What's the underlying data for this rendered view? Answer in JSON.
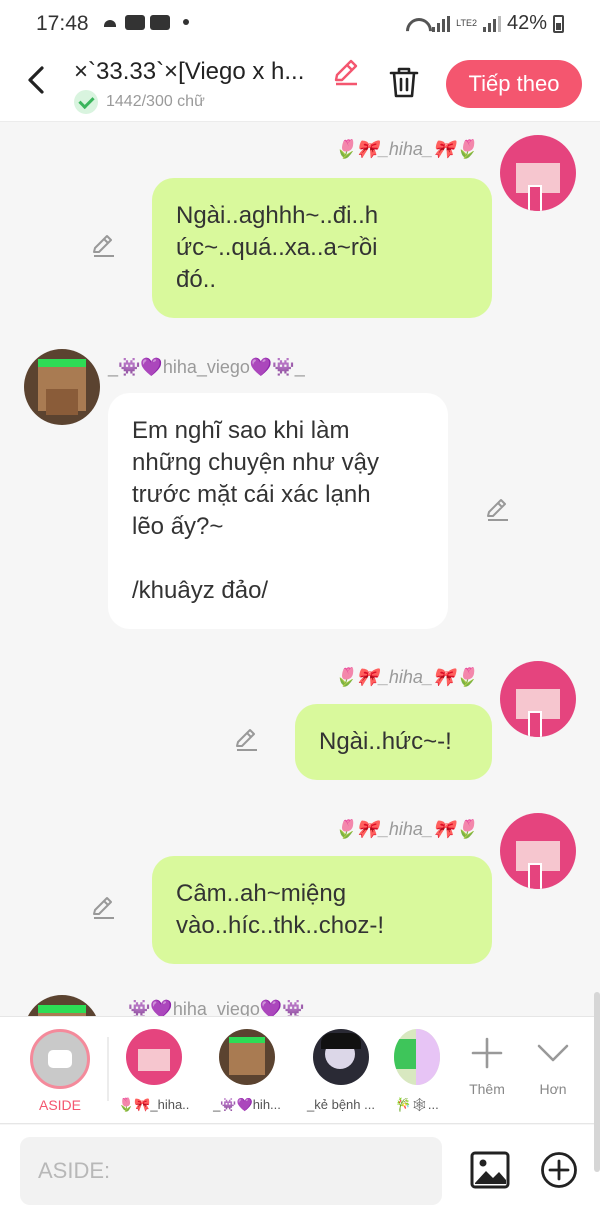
{
  "status_bar": {
    "time": "17:48",
    "battery": "42%",
    "network": "LTE2"
  },
  "header": {
    "title": "×`33.33`×[Viego x h...",
    "char_count": "1442/300 chữ",
    "next_label": "Tiếp theo",
    "accent_color": "#f4566f"
  },
  "messages": [
    {
      "side": "right",
      "author": "🌷🎀_hiha_🎀🌷",
      "text": "Ngài..aghhh~..đi..h\nức~..quá..xa..a~rồi\nđó.."
    },
    {
      "side": "left",
      "author": "_👾💜hiha_viego💜👾_",
      "text": "Em nghĩ sao khi làm\nnhững chuyện như vậy\ntrước mặt cái xác lạnh\nlẽo ấy?~\n\n/khuâyz đảo/"
    },
    {
      "side": "right",
      "author": "🌷🎀_hiha_🎀🌷",
      "text": "Ngài..hức~-!"
    },
    {
      "side": "right",
      "author": "🌷🎀_hiha_🎀🌷",
      "text": "Câm..ah~miệng\nvào..híc..thk..choz-!"
    },
    {
      "side": "left",
      "author": "_👾💜hiha_viego💜👾_",
      "text": ""
    }
  ],
  "selector": {
    "aside_label": "ASIDE",
    "characters": [
      {
        "name": "🌷🎀_hiha..."
      },
      {
        "name": "_👾💜hih..."
      },
      {
        "name": "_kẻ bệnh ..."
      },
      {
        "name": "🎋🕸..."
      }
    ],
    "more_label": "Thêm",
    "expand_label": "Hơn"
  },
  "input": {
    "placeholder": "ASIDE:"
  }
}
